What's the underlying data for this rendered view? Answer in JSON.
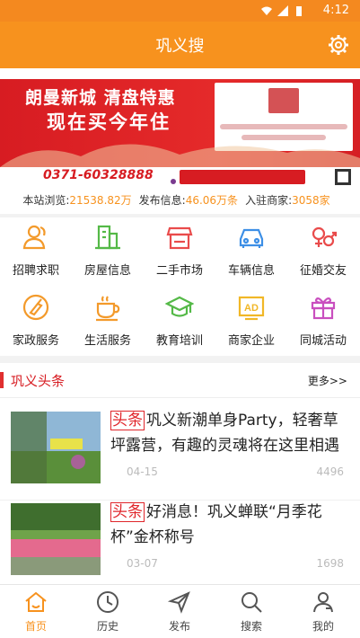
{
  "status": {
    "time": "4:12"
  },
  "header": {
    "title": "巩义搜",
    "settings_icon": "gear-icon"
  },
  "banner": {
    "line1": "朗曼新城 清盘特惠",
    "line2": "现在买今年住",
    "phone": "0371-60328888"
  },
  "stats": {
    "views_label": "本站浏览:",
    "views_value": "21538.82万",
    "posts_label": "发布信息:",
    "posts_value": "46.06万条",
    "merchants_label": "入驻商家:",
    "merchants_value": "3058家"
  },
  "categories": [
    {
      "label": "招聘求职",
      "icon": "people-icon",
      "color": "#f39a2b"
    },
    {
      "label": "房屋信息",
      "icon": "building-icon",
      "color": "#54b947"
    },
    {
      "label": "二手市场",
      "icon": "shop-icon",
      "color": "#e94b4b"
    },
    {
      "label": "车辆信息",
      "icon": "car-icon",
      "color": "#3d8fe6"
    },
    {
      "label": "征婚交友",
      "icon": "gender-icon",
      "color": "#e94b4b"
    },
    {
      "label": "家政服务",
      "icon": "broom-icon",
      "color": "#f39a2b"
    },
    {
      "label": "生活服务",
      "icon": "cup-icon",
      "color": "#f39a2b"
    },
    {
      "label": "教育培训",
      "icon": "graduation-cap-icon",
      "color": "#54b947"
    },
    {
      "label": "商家企业",
      "icon": "ad-icon",
      "color": "#f1b727"
    },
    {
      "label": "同城活动",
      "icon": "gift-icon",
      "color": "#c94fbf"
    }
  ],
  "news": {
    "title": "巩义头条",
    "more": "更多>>",
    "tag": "头条",
    "items": [
      {
        "text": "巩义新潮单身Party，轻奢草坪露营，有趣的灵魂将在这里相遇",
        "date": "04-15",
        "views": "4496"
      },
      {
        "text": "好消息！巩义蝉联“月季花杯”金杯称号",
        "date": "03-07",
        "views": "1698"
      }
    ]
  },
  "tabs": [
    {
      "label": "首页",
      "icon": "home-icon",
      "active": true
    },
    {
      "label": "历史",
      "icon": "clock-icon",
      "active": false
    },
    {
      "label": "发布",
      "icon": "send-icon",
      "active": false
    },
    {
      "label": "搜索",
      "icon": "search-icon",
      "active": false
    },
    {
      "label": "我的",
      "icon": "user-icon",
      "active": false
    }
  ],
  "colors": {
    "brand": "#f7921e",
    "accent_red": "#d71c22"
  }
}
